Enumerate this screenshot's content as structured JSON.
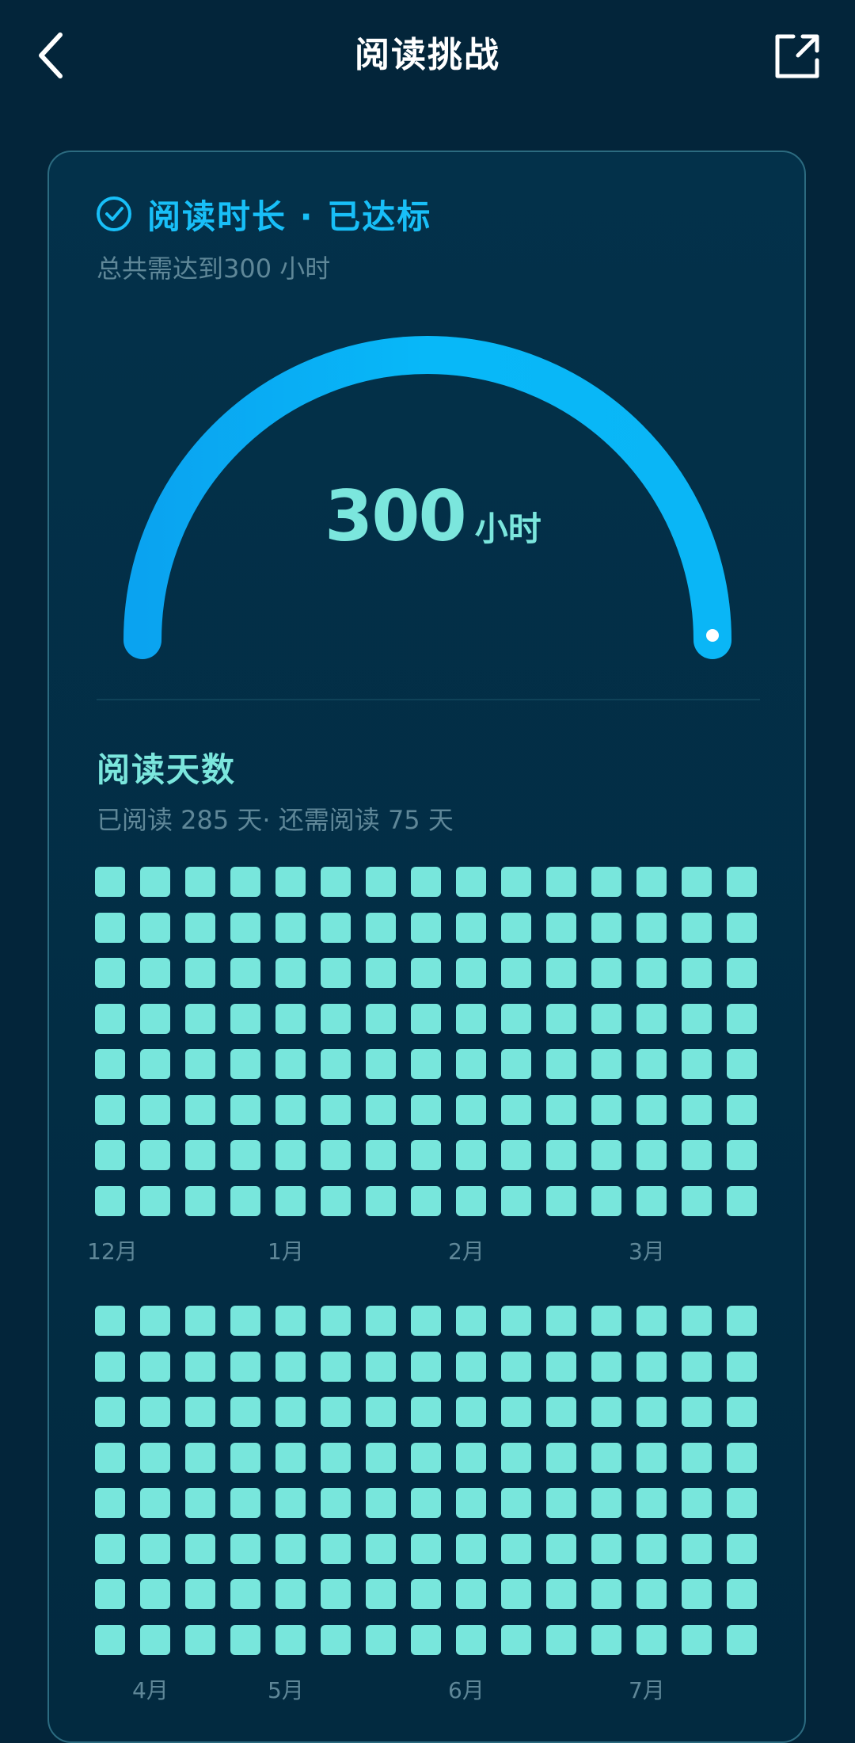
{
  "header": {
    "title": "阅读挑战",
    "back_icon": "chevron-left-icon",
    "share_icon": "share-external-icon"
  },
  "goal": {
    "title": "阅读时长 · 已达标",
    "subtitle": "总共需达到300 小时",
    "value": "300",
    "unit": "小时",
    "progress": 1.0,
    "icon": "check-circle-icon"
  },
  "days": {
    "title": "阅读天数",
    "subtitle": "已阅读 285 天· 还需阅读 75 天",
    "grids": [
      {
        "rows": 8,
        "columns": 15,
        "months": [
          "12月",
          "1月",
          "2月",
          "3月"
        ],
        "month_columns": [
          0,
          4,
          8,
          12
        ]
      },
      {
        "rows": 8,
        "columns": 15,
        "months": [
          "4月",
          "5月",
          "6月",
          "7月"
        ],
        "month_columns": [
          1,
          4,
          8,
          12
        ]
      }
    ]
  },
  "colors": {
    "background": "#03253a",
    "accent_blue": "#18bff8",
    "accent_teal": "#78e6dc",
    "muted_text": "#5f8798"
  }
}
